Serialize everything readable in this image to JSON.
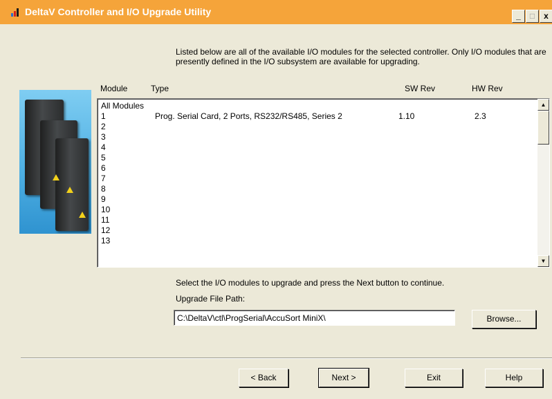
{
  "window": {
    "title": "DeltaV Controller and I/O Upgrade Utility",
    "icon": "deltav-bars-icon",
    "title_color": "#f5a43a",
    "controls": {
      "minimize": "_",
      "maximize": "□",
      "close": "x"
    }
  },
  "instructions": "Listed below are all of the available I/O modules for the selected controller. Only I/O modules that are presently defined in the I/O subsystem are available for upgrading.",
  "table": {
    "headers": {
      "module": "Module",
      "type": "Type",
      "sw_rev": "SW Rev",
      "hw_rev": "HW Rev"
    },
    "rows": [
      {
        "module": "All Modules",
        "type": "",
        "sw_rev": "",
        "hw_rev": ""
      },
      {
        "module": "1",
        "type": "Prog. Serial Card, 2 Ports, RS232/RS485, Series 2",
        "sw_rev": "1.10",
        "hw_rev": "2.3"
      },
      {
        "module": "2",
        "type": "",
        "sw_rev": "",
        "hw_rev": ""
      },
      {
        "module": "3",
        "type": "",
        "sw_rev": "",
        "hw_rev": ""
      },
      {
        "module": "4",
        "type": "",
        "sw_rev": "",
        "hw_rev": ""
      },
      {
        "module": "5",
        "type": "",
        "sw_rev": "",
        "hw_rev": ""
      },
      {
        "module": "6",
        "type": "",
        "sw_rev": "",
        "hw_rev": ""
      },
      {
        "module": "7",
        "type": "",
        "sw_rev": "",
        "hw_rev": ""
      },
      {
        "module": "8",
        "type": "",
        "sw_rev": "",
        "hw_rev": ""
      },
      {
        "module": "9",
        "type": "",
        "sw_rev": "",
        "hw_rev": ""
      },
      {
        "module": "10",
        "type": "",
        "sw_rev": "",
        "hw_rev": ""
      },
      {
        "module": "11",
        "type": "",
        "sw_rev": "",
        "hw_rev": ""
      },
      {
        "module": "12",
        "type": "",
        "sw_rev": "",
        "hw_rev": ""
      },
      {
        "module": "13",
        "type": "",
        "sw_rev": "",
        "hw_rev": ""
      }
    ]
  },
  "select_note": "Select the I/O modules to upgrade and press the Next button to continue.",
  "upgrade_path": {
    "label": "Upgrade File Path:",
    "value": "C:\\DeltaV\\ctl\\ProgSerial\\AccuSort MiniX\\"
  },
  "buttons": {
    "browse": "Browse...",
    "back": "< Back",
    "next": "Next >",
    "exit": "Exit",
    "help": "Help"
  }
}
